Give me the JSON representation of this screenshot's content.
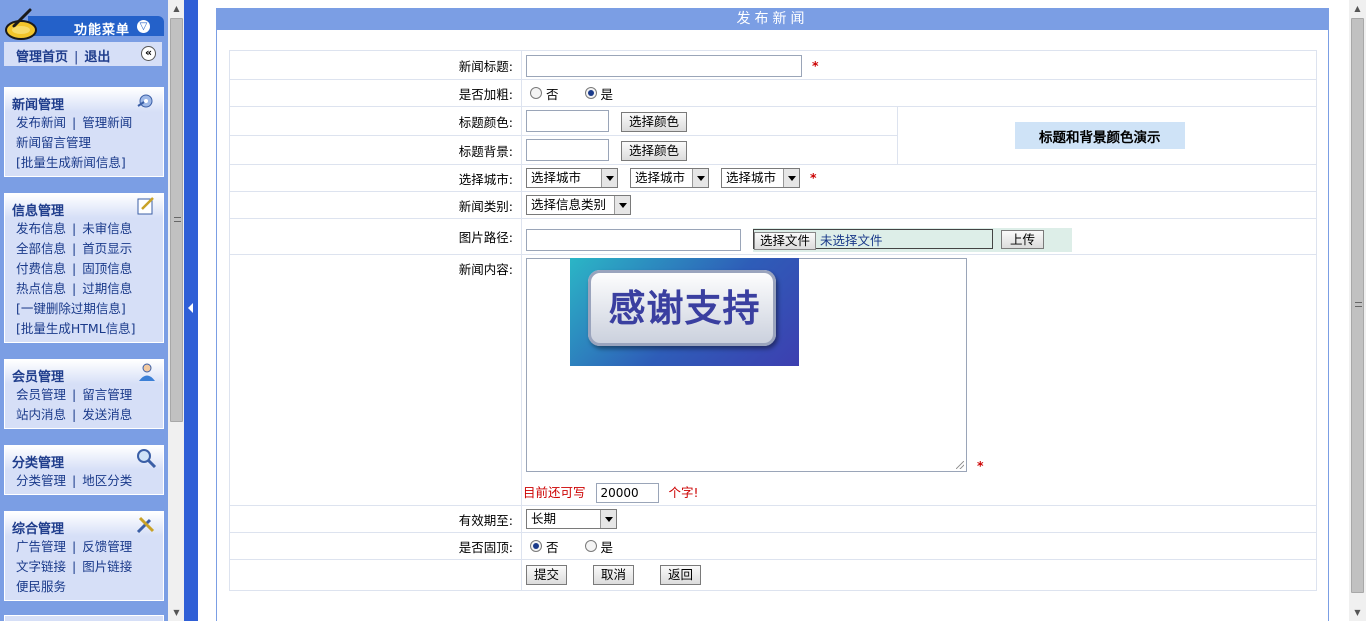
{
  "sidebar": {
    "menu_title": "功能菜单",
    "nav": {
      "home": "管理首页",
      "sep": "|",
      "logout": "退出"
    },
    "panels": [
      {
        "title": "新闻管理",
        "rows": [
          [
            "发布新闻",
            "管理新闻"
          ],
          [
            "新闻留言管理"
          ],
          [
            "[批量生成新闻信息]"
          ]
        ]
      },
      {
        "title": "信息管理",
        "rows": [
          [
            "发布信息",
            "未审信息"
          ],
          [
            "全部信息",
            "首页显示"
          ],
          [
            "付费信息",
            "固顶信息"
          ],
          [
            "热点信息",
            "过期信息"
          ],
          [
            "[一键删除过期信息]"
          ],
          [
            "[批量生成HTML信息]"
          ]
        ]
      },
      {
        "title": "会员管理",
        "rows": [
          [
            "会员管理",
            "留言管理"
          ],
          [
            "站内消息",
            "发送消息"
          ]
        ]
      },
      {
        "title": "分类管理",
        "rows": [
          [
            "分类管理",
            "地区分类"
          ]
        ]
      },
      {
        "title": "综合管理",
        "rows": [
          [
            "广告管理",
            "反馈管理"
          ],
          [
            "文字链接",
            "图片链接"
          ],
          [
            "便民服务"
          ]
        ]
      }
    ]
  },
  "main": {
    "header": "发布新闻",
    "fields": {
      "title_label": "新闻标题:",
      "bold_label": "是否加粗:",
      "bold_no": "否",
      "bold_yes": "是",
      "title_color_label": "标题颜色:",
      "title_bg_label": "标题背景:",
      "choose_color": "选择颜色",
      "color_demo": "标题和背景颜色演示",
      "city_label": "选择城市:",
      "city_placeholder": "选择城市",
      "category_label": "新闻类别:",
      "category_placeholder": "选择信息类别",
      "image_label": "图片路径:",
      "choose_file": "选择文件",
      "no_file": "未选择文件",
      "upload": "上传",
      "content_label": "新闻内容:",
      "thanks_image_text": "感谢支持",
      "remaining_prefix": "目前还可写",
      "remaining_value": "20000",
      "remaining_suffix": "个字!",
      "expire_label": "有效期至:",
      "expire_value": "长期",
      "pin_label": "是否固顶:",
      "pin_no": "否",
      "pin_yes": "是",
      "submit": "提交",
      "cancel": "取消",
      "back": "返回",
      "required_mark": "*"
    }
  },
  "colors": {
    "sidebar_bg": "#7b9ee4",
    "header_bar": "#2461c9",
    "panel_bg": "#d6dff7",
    "accent_red": "#cc0000"
  }
}
